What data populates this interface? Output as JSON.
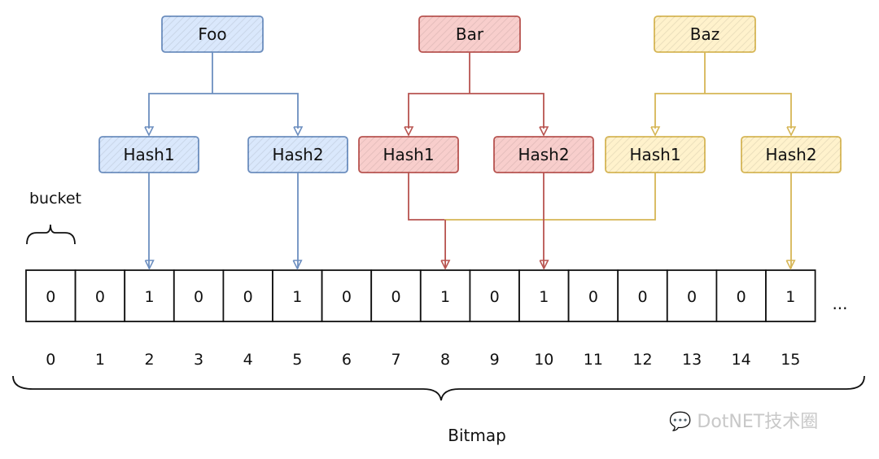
{
  "colors": {
    "foo": {
      "stroke": "#6c8ebf",
      "fill": "#dae8fc"
    },
    "bar": {
      "stroke": "#b85450",
      "fill": "#f8cecc"
    },
    "baz": {
      "stroke": "#d6b656",
      "fill": "#fff2cc"
    }
  },
  "keys": [
    {
      "id": "foo",
      "label": "Foo",
      "hashes": [
        "Hash1",
        "Hash2"
      ],
      "targets": [
        2,
        5
      ]
    },
    {
      "id": "bar",
      "label": "Bar",
      "hashes": [
        "Hash1",
        "Hash2"
      ],
      "targets": [
        8,
        10
      ]
    },
    {
      "id": "baz",
      "label": "Baz",
      "hashes": [
        "Hash1",
        "Hash2"
      ],
      "targets": [
        8,
        15
      ]
    }
  ],
  "bits": [
    0,
    0,
    1,
    0,
    0,
    1,
    0,
    0,
    1,
    0,
    1,
    0,
    0,
    0,
    0,
    1
  ],
  "indices": [
    "0",
    "1",
    "2",
    "3",
    "4",
    "5",
    "6",
    "7",
    "8",
    "9",
    "10",
    "11",
    "12",
    "13",
    "14",
    "15"
  ],
  "ellipsis": "...",
  "bucket_label": "bucket",
  "bitmap_label": "Bitmap",
  "watermark": "DotNET技术圈"
}
